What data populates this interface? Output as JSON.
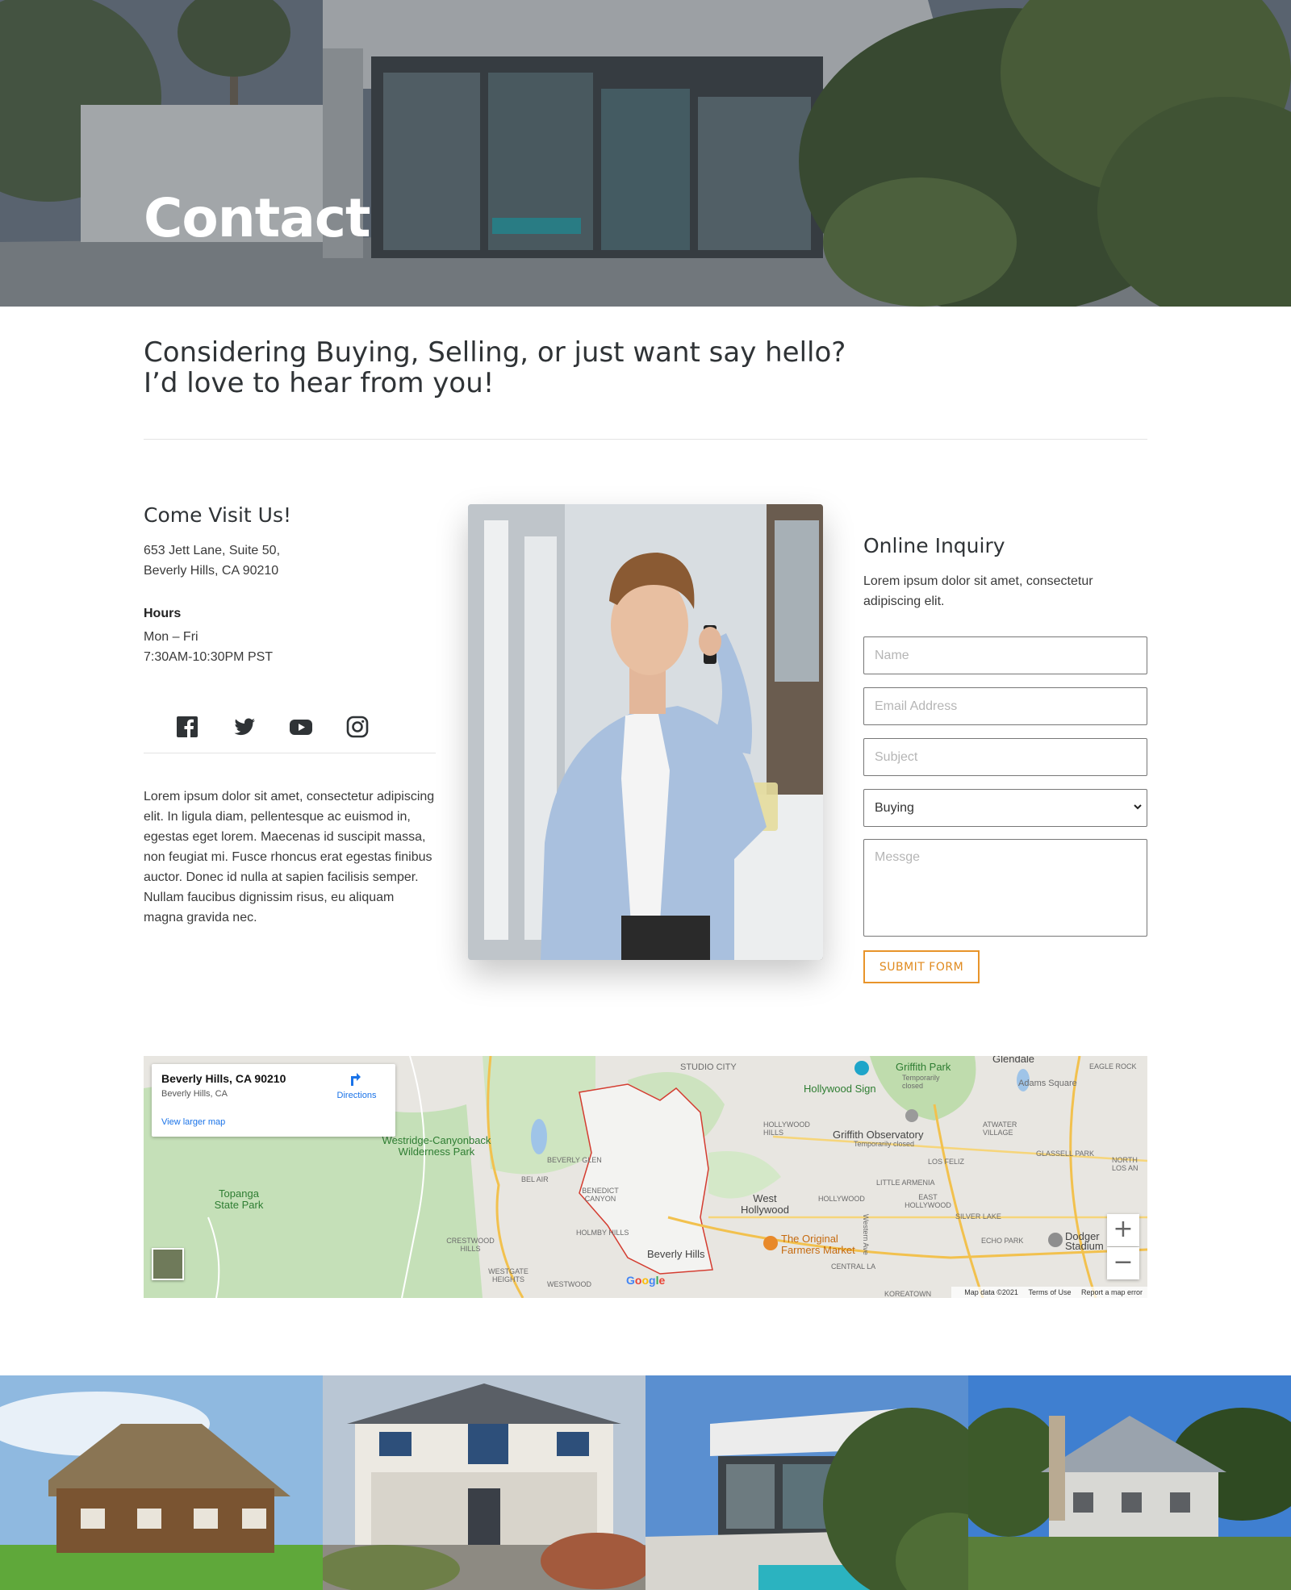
{
  "hero": {
    "title": "Contact"
  },
  "intro": {
    "line1": "Considering Buying, Selling, or just want say hello?",
    "line2": "I’d love to hear from you!"
  },
  "visit": {
    "title": "Come Visit Us!",
    "address_line1": "653 Jett Lane, Suite 50,",
    "address_line2": "Beverly Hills, CA 90210",
    "hours_heading": "Hours",
    "hours_days": "Mon – Fri",
    "hours_time": "7:30AM-10:30PM PST"
  },
  "social": {
    "icons": [
      "facebook-icon",
      "twitter-icon",
      "youtube-icon",
      "instagram-icon"
    ],
    "color": "#2f3336"
  },
  "bio": "Lorem ipsum dolor sit amet, consectetur adipiscing elit. In ligula diam, pellentesque ac euismod in, egestas eget lorem. Maecenas id suscipit massa, non feugiat mi. Fusce rhoncus erat egestas finibus auctor. Donec id nulla at sapien facilisis semper. Nullam faucibus dignissim risus, eu aliquam magna gravida nec.",
  "inquiry": {
    "title": "Online Inquiry",
    "description": "Lorem ipsum dolor sit amet, consectetur adipiscing elit.",
    "name_placeholder": "Name",
    "email_placeholder": "Email Address",
    "subject_placeholder": "Subject",
    "topic_selected": "Buying",
    "message_placeholder": "Messge",
    "submit_label": "SUBMIT FORM",
    "accent_color": "#e8942a"
  },
  "map": {
    "place_name": "Beverly Hills, CA 90210",
    "place_sub": "Beverly Hills, CA",
    "directions_label": "Directions",
    "larger_map_label": "View larger map",
    "zoom_in": "+",
    "zoom_out": "−",
    "google_label": "Google",
    "footer": {
      "data": "Map data ©2021",
      "terms": "Terms of Use",
      "report": "Report a map error"
    },
    "labels": {
      "studio_city": "STUDIO CITY",
      "griffith_park": "Griffith Park",
      "glendale": "Glendale",
      "eagle_rock": "EAGLE ROCK",
      "adams_square": "Adams Square",
      "hollywood_sign": "Hollywood Sign",
      "temporarily_closed_1": "Temporarily closed",
      "hollywood_hills": "HOLLYWOOD HILLS",
      "griffith_observatory": "Griffith Observatory",
      "temporarily_closed_2": "Temporarily closed",
      "atwater_village": "ATWATER VILLAGE",
      "wilderness_park": "Westridge-Canyonback Wilderness Park",
      "beverly_glen": "BEVERLY GLEN",
      "los_feliz": "LOS FELIZ",
      "glassell_park": "GLASSELL PARK",
      "north_los_an": "NORTH LOS AN",
      "bel_air": "BEL AIR",
      "little_armenia": "LITTLE ARMENIA",
      "topanga": "Topanga State Park",
      "benedict_canyon": "BENEDICT CANYON",
      "west_hollywood": "West Hollywood",
      "hollywood": "HOLLYWOOD",
      "east_hollywood": "EAST HOLLYWOOD",
      "silver_lake": "SILVER LAKE",
      "holmby_hills": "HOLMBY HILLS",
      "the_original": "The Original Farmers Market",
      "echo_park": "ECHO PARK",
      "dodger": "Dodger Stadium",
      "crestwood_hills": "CRESTWOOD HILLS",
      "beverly_hills": "Beverly Hills",
      "central_la": "CENTRAL LA",
      "westgate_heights": "WESTGATE HEIGHTS",
      "westwood": "WESTWOOD",
      "koreatown": "KOREATOWN",
      "western_ave": "Western Ave"
    }
  },
  "gallery": [
    "house-thatched",
    "house-craftsman",
    "house-modern",
    "house-stone"
  ]
}
